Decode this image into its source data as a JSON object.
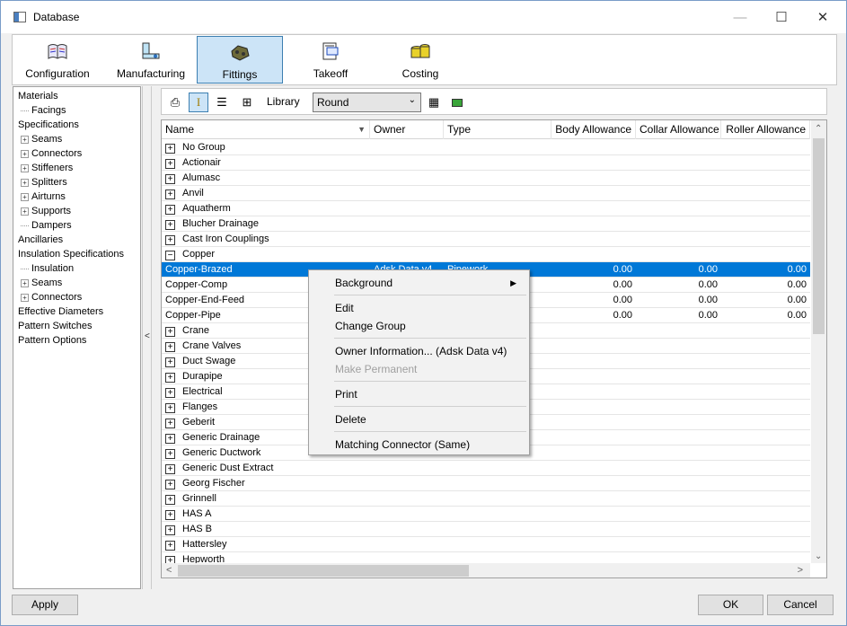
{
  "window": {
    "title": "Database"
  },
  "ribbon": {
    "items": [
      {
        "label": "Configuration",
        "icon": "book-icon"
      },
      {
        "label": "Manufacturing",
        "icon": "machine-icon"
      },
      {
        "label": "Fittings",
        "icon": "fitting-icon",
        "active": true
      },
      {
        "label": "Takeoff",
        "icon": "takeoff-icon"
      },
      {
        "label": "Costing",
        "icon": "coins-icon"
      }
    ]
  },
  "tree": {
    "items": [
      {
        "label": "Materials",
        "level": 0,
        "marker": "none"
      },
      {
        "label": "Facings",
        "level": 1,
        "marker": "line"
      },
      {
        "label": "Specifications",
        "level": 0,
        "marker": "none"
      },
      {
        "label": "Seams",
        "level": 1,
        "marker": "plus"
      },
      {
        "label": "Connectors",
        "level": 1,
        "marker": "plus"
      },
      {
        "label": "Stiffeners",
        "level": 1,
        "marker": "plus"
      },
      {
        "label": "Splitters",
        "level": 1,
        "marker": "plus"
      },
      {
        "label": "Airturns",
        "level": 1,
        "marker": "plus"
      },
      {
        "label": "Supports",
        "level": 1,
        "marker": "plus"
      },
      {
        "label": "Dampers",
        "level": 1,
        "marker": "line"
      },
      {
        "label": "Ancillaries",
        "level": 0,
        "marker": "none"
      },
      {
        "label": "Insulation Specifications",
        "level": 0,
        "marker": "none"
      },
      {
        "label": "Insulation",
        "level": 1,
        "marker": "line"
      },
      {
        "label": "Seams",
        "level": 1,
        "marker": "plus"
      },
      {
        "label": "Connectors",
        "level": 1,
        "marker": "plus"
      },
      {
        "label": "Effective Diameters",
        "level": 0,
        "marker": "none"
      },
      {
        "label": "Pattern Switches",
        "level": 0,
        "marker": "none"
      },
      {
        "label": "Pattern Options",
        "level": 0,
        "marker": "none"
      }
    ]
  },
  "toolbar": {
    "library_label": "Library",
    "library_value": "Round"
  },
  "grid": {
    "columns": {
      "name": "Name",
      "owner": "Owner",
      "type": "Type",
      "body": "Body Allowance",
      "collar": "Collar Allowance",
      "roller": "Roller Allowance"
    },
    "rows": [
      {
        "kind": "group",
        "expanded": false,
        "name": "No Group"
      },
      {
        "kind": "group",
        "expanded": false,
        "name": "Actionair"
      },
      {
        "kind": "group",
        "expanded": false,
        "name": "Alumasc"
      },
      {
        "kind": "group",
        "expanded": false,
        "name": "Anvil"
      },
      {
        "kind": "group",
        "expanded": false,
        "name": "Aquatherm"
      },
      {
        "kind": "group",
        "expanded": false,
        "name": "Blucher Drainage"
      },
      {
        "kind": "group",
        "expanded": false,
        "name": "Cast Iron Couplings"
      },
      {
        "kind": "group",
        "expanded": true,
        "name": "Copper"
      },
      {
        "kind": "item",
        "selected": true,
        "name": "Copper-Brazed",
        "owner": "Adsk Data v4",
        "type": "Pipework",
        "body": "0.00",
        "collar": "0.00",
        "roller": "0.00"
      },
      {
        "kind": "item",
        "name": "Copper-Comp",
        "owner": "",
        "type": "",
        "body": "0.00",
        "collar": "0.00",
        "roller": "0.00"
      },
      {
        "kind": "item",
        "name": "Copper-End-Feed",
        "owner": "",
        "type": "",
        "body": "0.00",
        "collar": "0.00",
        "roller": "0.00"
      },
      {
        "kind": "item",
        "name": "Copper-Pipe",
        "owner": "",
        "type": "",
        "body": "0.00",
        "collar": "0.00",
        "roller": "0.00"
      },
      {
        "kind": "group",
        "expanded": false,
        "name": "Crane"
      },
      {
        "kind": "group",
        "expanded": false,
        "name": "Crane Valves"
      },
      {
        "kind": "group",
        "expanded": false,
        "name": "Duct Swage"
      },
      {
        "kind": "group",
        "expanded": false,
        "name": "Durapipe"
      },
      {
        "kind": "group",
        "expanded": false,
        "name": "Electrical"
      },
      {
        "kind": "group",
        "expanded": false,
        "name": "Flanges"
      },
      {
        "kind": "group",
        "expanded": false,
        "name": "Geberit"
      },
      {
        "kind": "group",
        "expanded": false,
        "name": "Generic Drainage"
      },
      {
        "kind": "group",
        "expanded": false,
        "name": "Generic Ductwork"
      },
      {
        "kind": "group",
        "expanded": false,
        "name": "Generic Dust Extract"
      },
      {
        "kind": "group",
        "expanded": false,
        "name": "Georg Fischer"
      },
      {
        "kind": "group",
        "expanded": false,
        "name": "Grinnell"
      },
      {
        "kind": "group",
        "expanded": false,
        "name": "HAS A"
      },
      {
        "kind": "group",
        "expanded": false,
        "name": "HAS B"
      },
      {
        "kind": "group",
        "expanded": false,
        "name": "Hattersley"
      },
      {
        "kind": "group",
        "expanded": false,
        "name": "Hepworth"
      }
    ]
  },
  "context_menu": {
    "items": [
      {
        "label": "Background",
        "submenu": true
      },
      {
        "label": "Edit"
      },
      {
        "label": "Change Group"
      },
      {
        "label": "Owner Information... (Adsk Data v4)"
      },
      {
        "label": "Make Permanent",
        "disabled": true
      },
      {
        "label": "Print"
      },
      {
        "label": "Delete"
      },
      {
        "label": "Matching Connector (Same)"
      }
    ]
  },
  "footer": {
    "apply": "Apply",
    "ok": "OK",
    "cancel": "Cancel"
  }
}
